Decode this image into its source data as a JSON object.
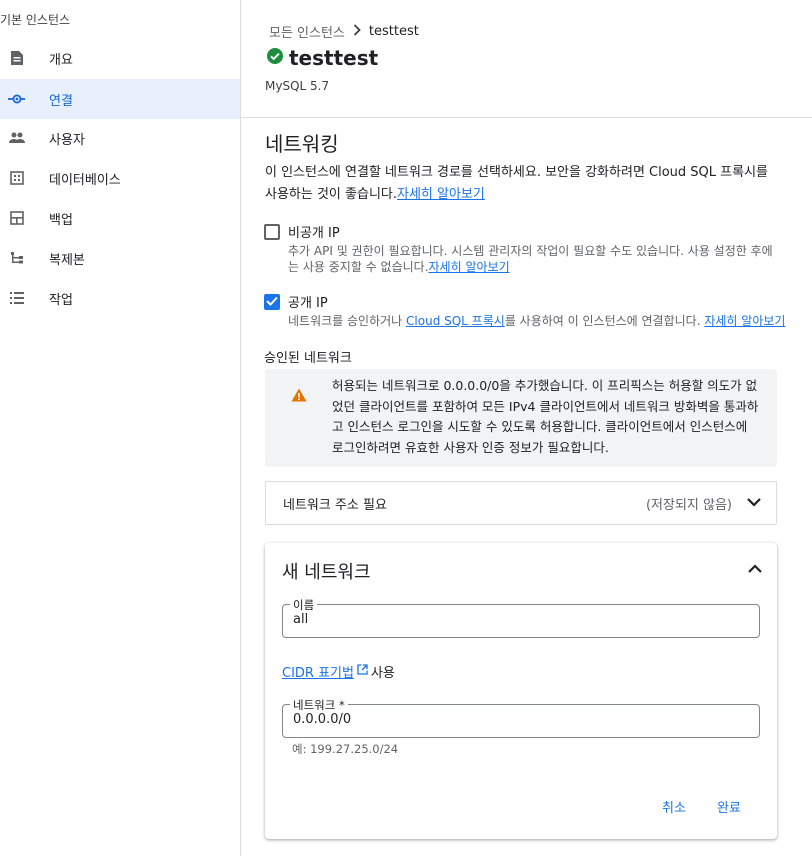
{
  "sidebar": {
    "header": "기본 인스턴스",
    "items": [
      {
        "label": "개요",
        "icon": "overview-icon"
      },
      {
        "label": "연결",
        "icon": "connection-icon",
        "active": true
      },
      {
        "label": "사용자",
        "icon": "users-icon"
      },
      {
        "label": "데이터베이스",
        "icon": "database-icon"
      },
      {
        "label": "백업",
        "icon": "backup-icon"
      },
      {
        "label": "복제본",
        "icon": "replica-icon"
      },
      {
        "label": "작업",
        "icon": "operations-icon"
      }
    ]
  },
  "breadcrumb": {
    "parent": "모든 인스턴스",
    "current": "testtest"
  },
  "instance": {
    "name": "testtest",
    "version": "MySQL 5.7",
    "status": "running"
  },
  "networking": {
    "title": "네트워킹",
    "description": "이 인스턴스에 연결할 네트워크 경로를 선택하세요. 보안을 강화하려면 Cloud SQL 프록시를 사용하는 것이 좋습니다.",
    "learn_more": "자세히 알아보기",
    "private_ip": {
      "label": "비공개 IP",
      "checked": false,
      "description": "추가 API 및 권한이 필요합니다. 시스템 관리자의 작업이 필요할 수도 있습니다. 사용 설정한 후에는 사용 중지할 수 없습니다.",
      "learn_more": "자세히 알아보기"
    },
    "public_ip": {
      "label": "공개 IP",
      "checked": true,
      "description_before": "네트워크를 승인하거나 ",
      "proxy_link": "Cloud SQL 프록시",
      "description_after": "를 사용하여 이 인스턴스에 연결합니다. ",
      "learn_more": "자세히 알아보기"
    },
    "authorized_title": "승인된 네트워크",
    "warning": "허용되는 네트워크로 0.0.0.0/0을 추가했습니다. 이 프리픽스는 허용할 의도가 없었던 클라이언트를 포함하여 모든 IPv4 클라이언트에서 네트워크 방화벽을 통과하고 인스턴스 로그인을 시도할 수 있도록 허용합니다. 클라이언트에서 인스턴스에 로그인하려면 유효한 사용자 인증 정보가 필요합니다.",
    "collapsed_item": {
      "title": "네트워크 주소 필요",
      "status": "(저장되지 않음)"
    },
    "new_network": {
      "title": "새 네트워크",
      "name_label": "이름",
      "name_value": "all",
      "cidr_link": "CIDR 표기법",
      "cidr_suffix": "사용",
      "network_label": "네트워크 *",
      "network_value": "0.0.0.0/0",
      "hint": "예: 199.27.25.0/24",
      "cancel": "취소",
      "done": "완료"
    }
  },
  "colors": {
    "accent": "#1a73e8",
    "success": "#1e8e3e",
    "warning": "#e37400",
    "active_bg": "#e8f0fe"
  }
}
